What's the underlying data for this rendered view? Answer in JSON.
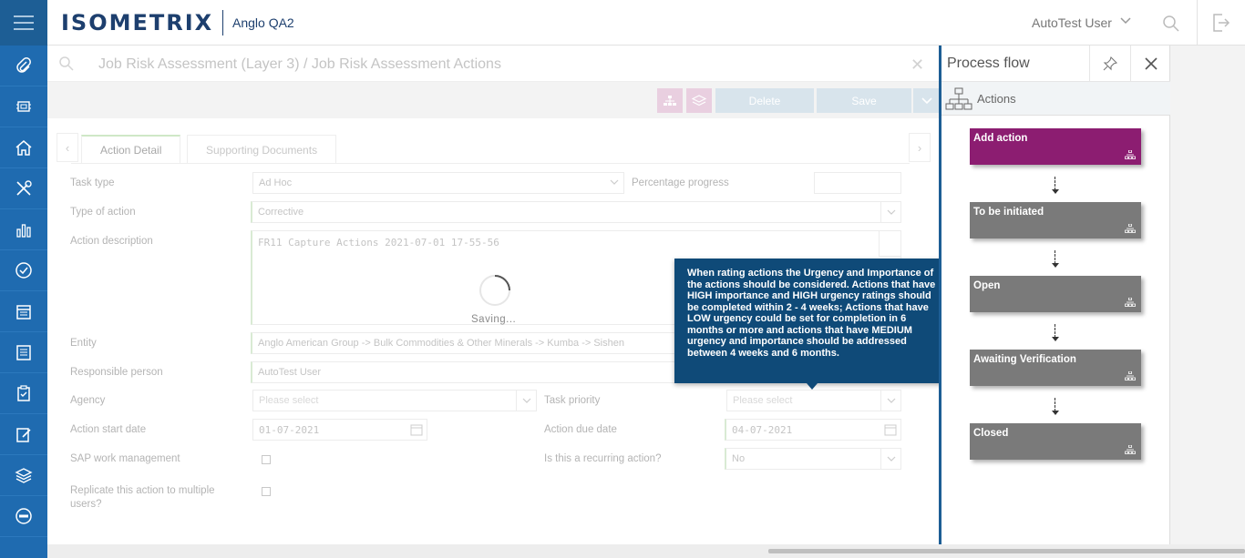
{
  "header": {
    "logo": "ISOMETRIX",
    "site": "Anglo QA2",
    "user": "AutoTest User"
  },
  "sidebar": {
    "items": [
      "paperclip-icon",
      "chip-icon",
      "home-icon",
      "tools-icon",
      "chart-icon",
      "check-circle-icon",
      "calendar-icon",
      "list-icon",
      "clipboard-check-icon",
      "edit-note-icon",
      "layers-icon",
      "no-entry-icon"
    ]
  },
  "breadcrumb": {
    "text": "Job Risk Assessment (Layer 3)  /  Job Risk Assessment Actions"
  },
  "toolbar": {
    "delete_label": "Delete",
    "save_label": "Save"
  },
  "tabs": [
    {
      "label": "Action Detail"
    },
    {
      "label": "Supporting Documents"
    }
  ],
  "form": {
    "task_type": {
      "label": "Task type",
      "value": "Ad Hoc"
    },
    "percentage_progress": {
      "label": "Percentage progress",
      "value": ""
    },
    "type_of_action": {
      "label": "Type of action",
      "value": "Corrective"
    },
    "action_description": {
      "label": "Action description",
      "value": "FR11 Capture Actions 2021-07-01 17-55-56"
    },
    "entity": {
      "label": "Entity",
      "value": "Anglo American Group -> Bulk Commodities & Other Minerals -> Kumba -> Sishen"
    },
    "responsible_person": {
      "label": "Responsible person",
      "value": "AutoTest User"
    },
    "agency": {
      "label": "Agency",
      "placeholder": "Please select"
    },
    "task_priority": {
      "label": "Task priority",
      "placeholder": "Please select"
    },
    "action_start_date": {
      "label": "Action start date",
      "value": "01-07-2021"
    },
    "action_due_date": {
      "label": "Action due date",
      "value": "04-07-2021"
    },
    "sap_work_management": {
      "label": "SAP work management"
    },
    "recurring": {
      "label": "Is this a recurring action?",
      "value": "No"
    },
    "replicate_line1": "Replicate this action to multiple",
    "replicate_line2": "users?"
  },
  "saving": {
    "text": "Saving..."
  },
  "tooltip": {
    "text": "When rating actions the Urgency and Importance of the actions should be considered. Actions that have HIGH importance and HIGH urgency ratings should be completed within 2 - 4 weeks; Actions that have LOW urgency could be set for completion in 6 months or more and actions that have MEDIUM urgency and importance should be addressed between 4 weeks and 6 months."
  },
  "process_flow": {
    "title": "Process flow",
    "subtitle": "Actions",
    "steps": [
      {
        "label": "Add action",
        "color": "#8c1d71"
      },
      {
        "label": "To be initiated",
        "color": "#7a7a7a"
      },
      {
        "label": "Open",
        "color": "#7a7a7a"
      },
      {
        "label": "Awaiting Verification",
        "color": "#7a7a7a"
      },
      {
        "label": "Closed",
        "color": "#7a7a7a"
      }
    ]
  },
  "colors": {
    "brand_blue": "#1f6bb0",
    "dark_blue": "#1d3f6e",
    "tooltip_bg": "#0f4a78",
    "active_step": "#8c1d71",
    "inactive_step": "#7a7a7a"
  }
}
